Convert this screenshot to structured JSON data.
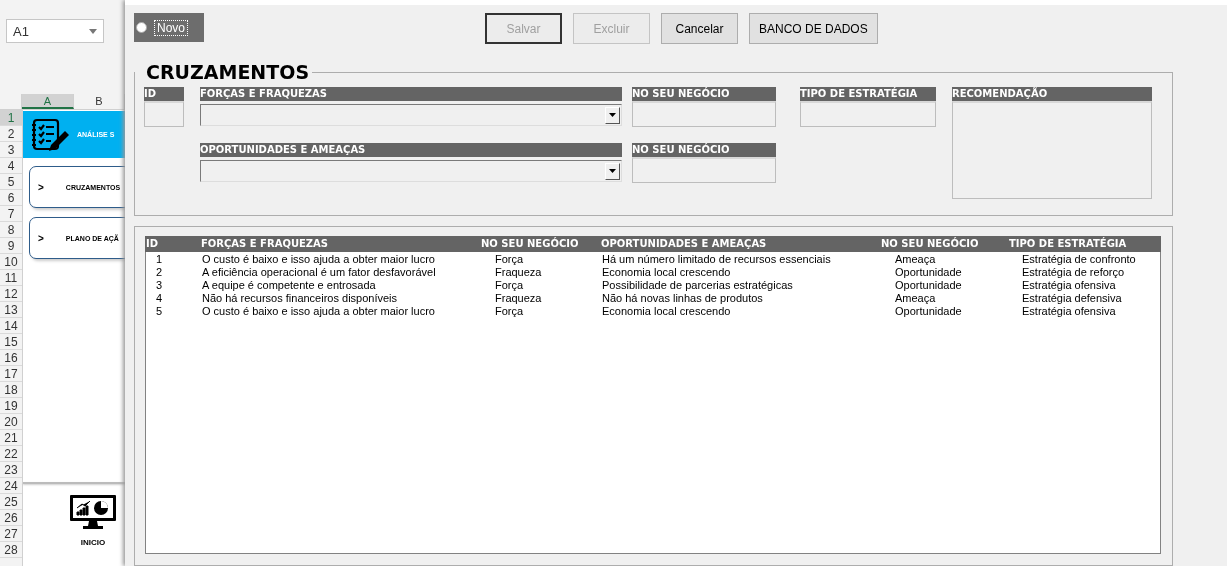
{
  "spreadsheet": {
    "name_box": "A1",
    "columns": [
      {
        "label": "A",
        "selected": true
      },
      {
        "label": "B",
        "selected": false
      }
    ],
    "rows": [
      {
        "label": "1",
        "selected": true
      },
      {
        "label": "2",
        "selected": false
      },
      {
        "label": "3",
        "selected": false
      },
      {
        "label": "4",
        "selected": false
      },
      {
        "label": "5",
        "selected": false
      },
      {
        "label": "6",
        "selected": false
      },
      {
        "label": "7",
        "selected": false
      },
      {
        "label": "8",
        "selected": false
      },
      {
        "label": "9",
        "selected": false
      },
      {
        "label": "10",
        "selected": false
      },
      {
        "label": "11",
        "selected": false
      },
      {
        "label": "12",
        "selected": false
      },
      {
        "label": "13",
        "selected": false
      },
      {
        "label": "14",
        "selected": false
      },
      {
        "label": "15",
        "selected": false
      },
      {
        "label": "16",
        "selected": false
      },
      {
        "label": "17",
        "selected": false
      },
      {
        "label": "18",
        "selected": false
      },
      {
        "label": "19",
        "selected": false
      },
      {
        "label": "20",
        "selected": false
      },
      {
        "label": "21",
        "selected": false
      },
      {
        "label": "22",
        "selected": false
      },
      {
        "label": "23",
        "selected": false
      },
      {
        "label": "24",
        "selected": false
      },
      {
        "label": "25",
        "selected": false
      },
      {
        "label": "26",
        "selected": false
      },
      {
        "label": "27",
        "selected": false
      },
      {
        "label": "28",
        "selected": false
      }
    ],
    "banner": {
      "title": "ANÁLISE S"
    },
    "menu_cards": [
      {
        "arrow": ">",
        "label": "CRUZAMENTOS"
      },
      {
        "arrow": ">",
        "label": "PLANO DE AÇÃ"
      }
    ],
    "home": {
      "label": "INICIO"
    }
  },
  "form": {
    "new_option": {
      "label": "Novo",
      "selected": false
    },
    "buttons": [
      {
        "label": "Salvar",
        "disabled": true
      },
      {
        "label": "Excluir",
        "disabled": true
      },
      {
        "label": "Cancelar",
        "disabled": false
      },
      {
        "label": "BANCO DE DADOS",
        "disabled": false
      }
    ],
    "frame": {
      "title": "CRUZAMENTOS",
      "fields": [
        {
          "kind": "text",
          "label": "ID"
        },
        {
          "kind": "combo",
          "label": "FORÇAS E FRAQUEZAS"
        },
        {
          "kind": "text",
          "label": "NO SEU NEGÓCIO"
        },
        {
          "kind": "text",
          "label": "TIPO DE ESTRATÉGIA"
        },
        {
          "kind": "memo",
          "label": "RECOMENDAÇÃO"
        },
        {
          "kind": "combo",
          "label": "OPORTUNIDADES E AMEAÇAS"
        },
        {
          "kind": "text",
          "label": "NO SEU NEGÓCIO"
        }
      ]
    },
    "table": {
      "columns": [
        "ID",
        "FORÇAS E FRAQUEZAS",
        "NO SEU NEGÓCIO",
        "OPORTUNIDADES E AMEAÇAS",
        "NO SEU NEGÓCIO",
        "TIPO DE ESTRATÉGIA"
      ],
      "rows": [
        [
          "1",
          "O custo é baixo e isso ajuda a obter maior lucro",
          "Força",
          "Há um número limitado de recursos essenciais",
          "Ameaça",
          "Estratégia de confronto"
        ],
        [
          "2",
          "A eficiência operacional é um fator desfavorável",
          "Fraqueza",
          "Economia local crescendo",
          "Oportunidade",
          "Estratégia de reforço"
        ],
        [
          "3",
          "A equipe é competente e entrosada",
          "Força",
          "Possibilidade de parcerias estratégicas",
          "Oportunidade",
          "Estratégia ofensiva"
        ],
        [
          "4",
          "Não há recursos financeiros disponíveis",
          "Fraqueza",
          "Não há novas linhas de produtos",
          "Ameaça",
          "Estratégia defensiva"
        ],
        [
          "5",
          "O custo é baixo e isso ajuda a obter maior lucro",
          "Força",
          "Economia local crescendo",
          "Oportunidade",
          "Estratégia ofensiva"
        ]
      ]
    }
  }
}
